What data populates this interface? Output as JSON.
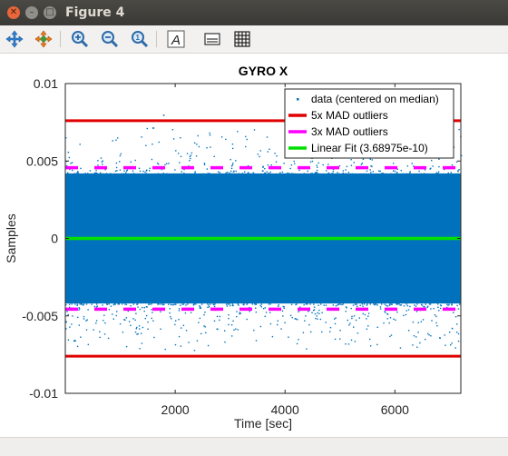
{
  "window": {
    "title": "Figure 4"
  },
  "toolbar": {
    "buttons": [
      "pan-icon",
      "rotate-icon",
      "zoom-in-icon",
      "zoom-out-icon",
      "zoom-reset-icon",
      "text-icon",
      "legend-icon",
      "grid-icon"
    ]
  },
  "colors": {
    "data": "#0072bd",
    "outlier5": "#e00000",
    "outlier3": "#ff00ff",
    "fit": "#00e000"
  },
  "chart_data": {
    "type": "scatter",
    "title": "GYRO X",
    "xlabel": "Time [sec]",
    "ylabel": "Samples",
    "xlim": [
      0,
      7200
    ],
    "ylim": [
      -0.01,
      0.01
    ],
    "xticks": [
      2000,
      4000,
      6000
    ],
    "xtick_labels": [
      "2000",
      "4000",
      "6000"
    ],
    "yticks": [
      0.01,
      0.005,
      0,
      -0.005,
      -0.01
    ],
    "ytick_labels": [
      "0.01",
      "0.005",
      "0",
      "-0.005",
      "-0.01"
    ],
    "grid": false,
    "legend_position": "top-right",
    "series": [
      {
        "name": "data (centered on median)",
        "kind": "scatter",
        "band": [
          -0.0042,
          0.0042
        ],
        "sparse_extent": [
          -0.0072,
          0.008
        ]
      },
      {
        "name": "5x MAD outliers",
        "kind": "hline",
        "y": [
          0.0076,
          -0.0076
        ]
      },
      {
        "name": "3x MAD outliers",
        "kind": "dashed-hline",
        "y": [
          0.00457,
          -0.00457
        ]
      },
      {
        "name": "Linear Fit (3.68975e-10)",
        "kind": "line",
        "y": [
          0,
          0
        ]
      }
    ]
  }
}
